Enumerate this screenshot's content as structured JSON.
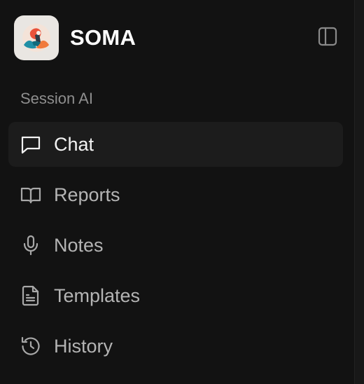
{
  "app": {
    "title": "SOMA",
    "logo_icon": "soma-logo-icon",
    "toggle_icon": "sidebar-toggle-icon"
  },
  "section": {
    "label": "Session AI"
  },
  "nav": {
    "items": [
      {
        "label": "Chat",
        "icon": "chat-bubble-icon",
        "active": true
      },
      {
        "label": "Reports",
        "icon": "book-open-icon",
        "active": false
      },
      {
        "label": "Notes",
        "icon": "microphone-icon",
        "active": false
      },
      {
        "label": "Templates",
        "icon": "document-icon",
        "active": false
      },
      {
        "label": "History",
        "icon": "history-icon",
        "active": false
      }
    ]
  },
  "colors": {
    "background": "#121212",
    "active_item": "#1c1c1c",
    "text_primary": "#ffffff",
    "text_secondary": "#b4b4b4",
    "section_label": "#8e8e8e"
  }
}
